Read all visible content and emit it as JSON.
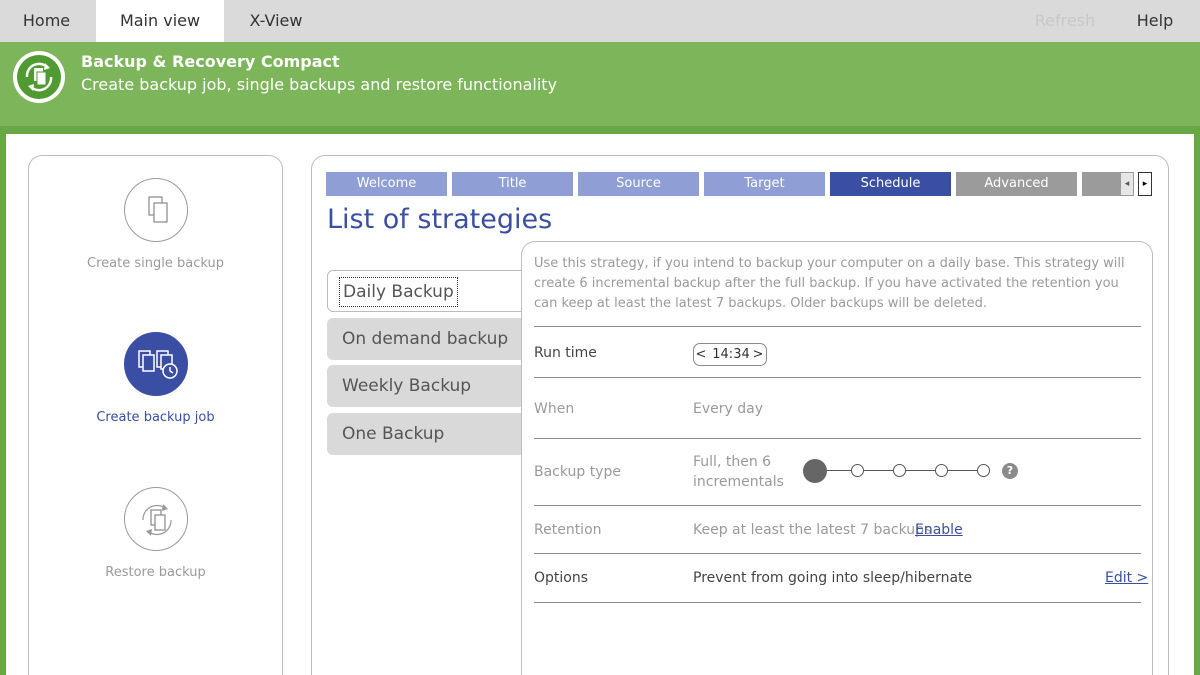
{
  "top_menu": {
    "tabs": [
      {
        "label": "Home"
      },
      {
        "label": "Main view"
      },
      {
        "label": "X-View"
      }
    ],
    "refresh_label": "Refresh",
    "help_label": "Help"
  },
  "header": {
    "title": "Backup & Recovery Compact",
    "subtitle": "Create backup job, single backups and restore functionality"
  },
  "actions": [
    {
      "label": "Create single backup"
    },
    {
      "label": "Create backup job"
    },
    {
      "label": "Restore backup"
    }
  ],
  "wizard": {
    "tabs": [
      {
        "label": "Welcome"
      },
      {
        "label": "Title"
      },
      {
        "label": "Source"
      },
      {
        "label": "Target"
      },
      {
        "label": "Schedule"
      },
      {
        "label": "Advanced Settings"
      }
    ],
    "scroll_left": "◂",
    "scroll_right": "▸"
  },
  "strategies": {
    "title": "List of strategies",
    "items": [
      {
        "label": "Daily Backup"
      },
      {
        "label": "On demand backup"
      },
      {
        "label": "Weekly Backup"
      },
      {
        "label": "One Backup"
      }
    ]
  },
  "detail": {
    "description": "Use this strategy, if you intend to backup your computer on a daily base. This strategy will create 6 incremental backup after the full backup. If you have activated the retention you can keep at least the latest 7 backups. Older backups will be deleted.",
    "run_time": {
      "label": "Run time",
      "value": "14:34",
      "prev": "<",
      "next": ">"
    },
    "when": {
      "label": "When",
      "value": "Every day"
    },
    "backup_type": {
      "label": "Backup type",
      "value_line1": "Full, then 6",
      "value_line2": "incrementals",
      "help": "?"
    },
    "retention": {
      "label": "Retention",
      "value": "Keep at least the latest 7 backups",
      "link": "Enable"
    },
    "options": {
      "label": "Options",
      "value": "Prevent from going into sleep/hibernate",
      "link": "Edit >"
    }
  },
  "colors": {
    "brand_green": "#7db55a",
    "accent_blue": "#3a4fa3",
    "tab_light_blue": "#8f9ed4"
  }
}
